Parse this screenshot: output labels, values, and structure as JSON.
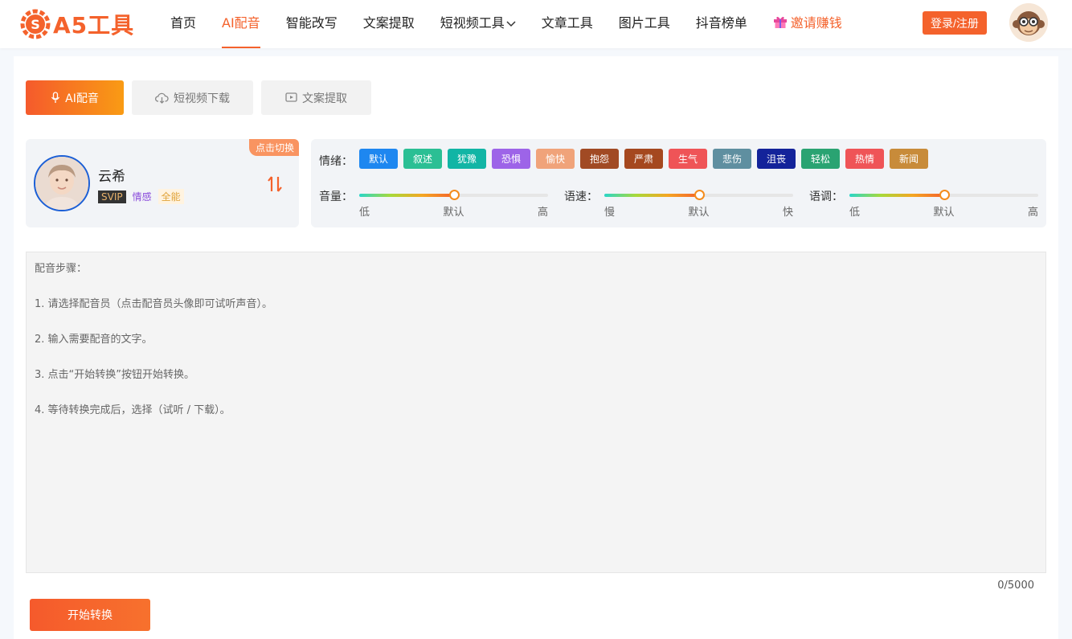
{
  "header": {
    "logo_text": "A5工具",
    "nav": [
      {
        "label": "首页",
        "active": false
      },
      {
        "label": "AI配音",
        "active": true
      },
      {
        "label": "智能改写",
        "active": false
      },
      {
        "label": "文案提取",
        "active": false
      },
      {
        "label": "短视频工具",
        "active": false
      },
      {
        "label": "文章工具",
        "active": false
      },
      {
        "label": "图片工具",
        "active": false
      },
      {
        "label": "抖音榜单",
        "active": false
      },
      {
        "label": "邀请赚钱",
        "active": false
      }
    ],
    "login_label": "登录/注册",
    "accent_color": "#f4622c"
  },
  "tabs": [
    {
      "label": "AI配音",
      "icon": "microphone-icon",
      "active": true
    },
    {
      "label": "短视频下载",
      "icon": "cloud-download-icon",
      "active": false
    },
    {
      "label": "文案提取",
      "icon": "video-text-icon",
      "active": false
    }
  ],
  "voice": {
    "name": "云希",
    "tags": [
      "SVIP",
      "情感",
      "全能"
    ],
    "switch_label": "点击切换"
  },
  "emotion": {
    "label": "情绪：",
    "items": [
      {
        "label": "默认",
        "color": "#1e87f0"
      },
      {
        "label": "叙述",
        "color": "#2bbf94"
      },
      {
        "label": "犹豫",
        "color": "#12b5a5"
      },
      {
        "label": "恐惧",
        "color": "#9d64e8"
      },
      {
        "label": "愉快",
        "color": "#f0a37a"
      },
      {
        "label": "抱怨",
        "color": "#a14a24"
      },
      {
        "label": "严肃",
        "color": "#a5481f"
      },
      {
        "label": "生气",
        "color": "#ef5457"
      },
      {
        "label": "悲伤",
        "color": "#5f8fa0"
      },
      {
        "label": "沮丧",
        "color": "#13239a"
      },
      {
        "label": "轻松",
        "color": "#2aa372"
      },
      {
        "label": "热情",
        "color": "#ef5457"
      },
      {
        "label": "新闻",
        "color": "#c88b3a"
      }
    ]
  },
  "sliders": [
    {
      "label": "音量：",
      "min": "低",
      "mid": "默认",
      "max": "高",
      "value": 0.5
    },
    {
      "label": "语速：",
      "min": "慢",
      "mid": "默认",
      "max": "快",
      "value": 0.5
    },
    {
      "label": "语调：",
      "min": "低",
      "mid": "默认",
      "max": "高",
      "value": 0.5
    }
  ],
  "editor": {
    "placeholder": "配音步骤：\n\n1. 请选择配音员（点击配音员头像即可试听声音）。\n\n2. 输入需要配音的文字。\n\n3. 点击“开始转换”按钮开始转换。\n\n4. 等待转换完成后，选择（试听 / 下载）。",
    "counter": "0/5000"
  },
  "start_label": "开始转换"
}
